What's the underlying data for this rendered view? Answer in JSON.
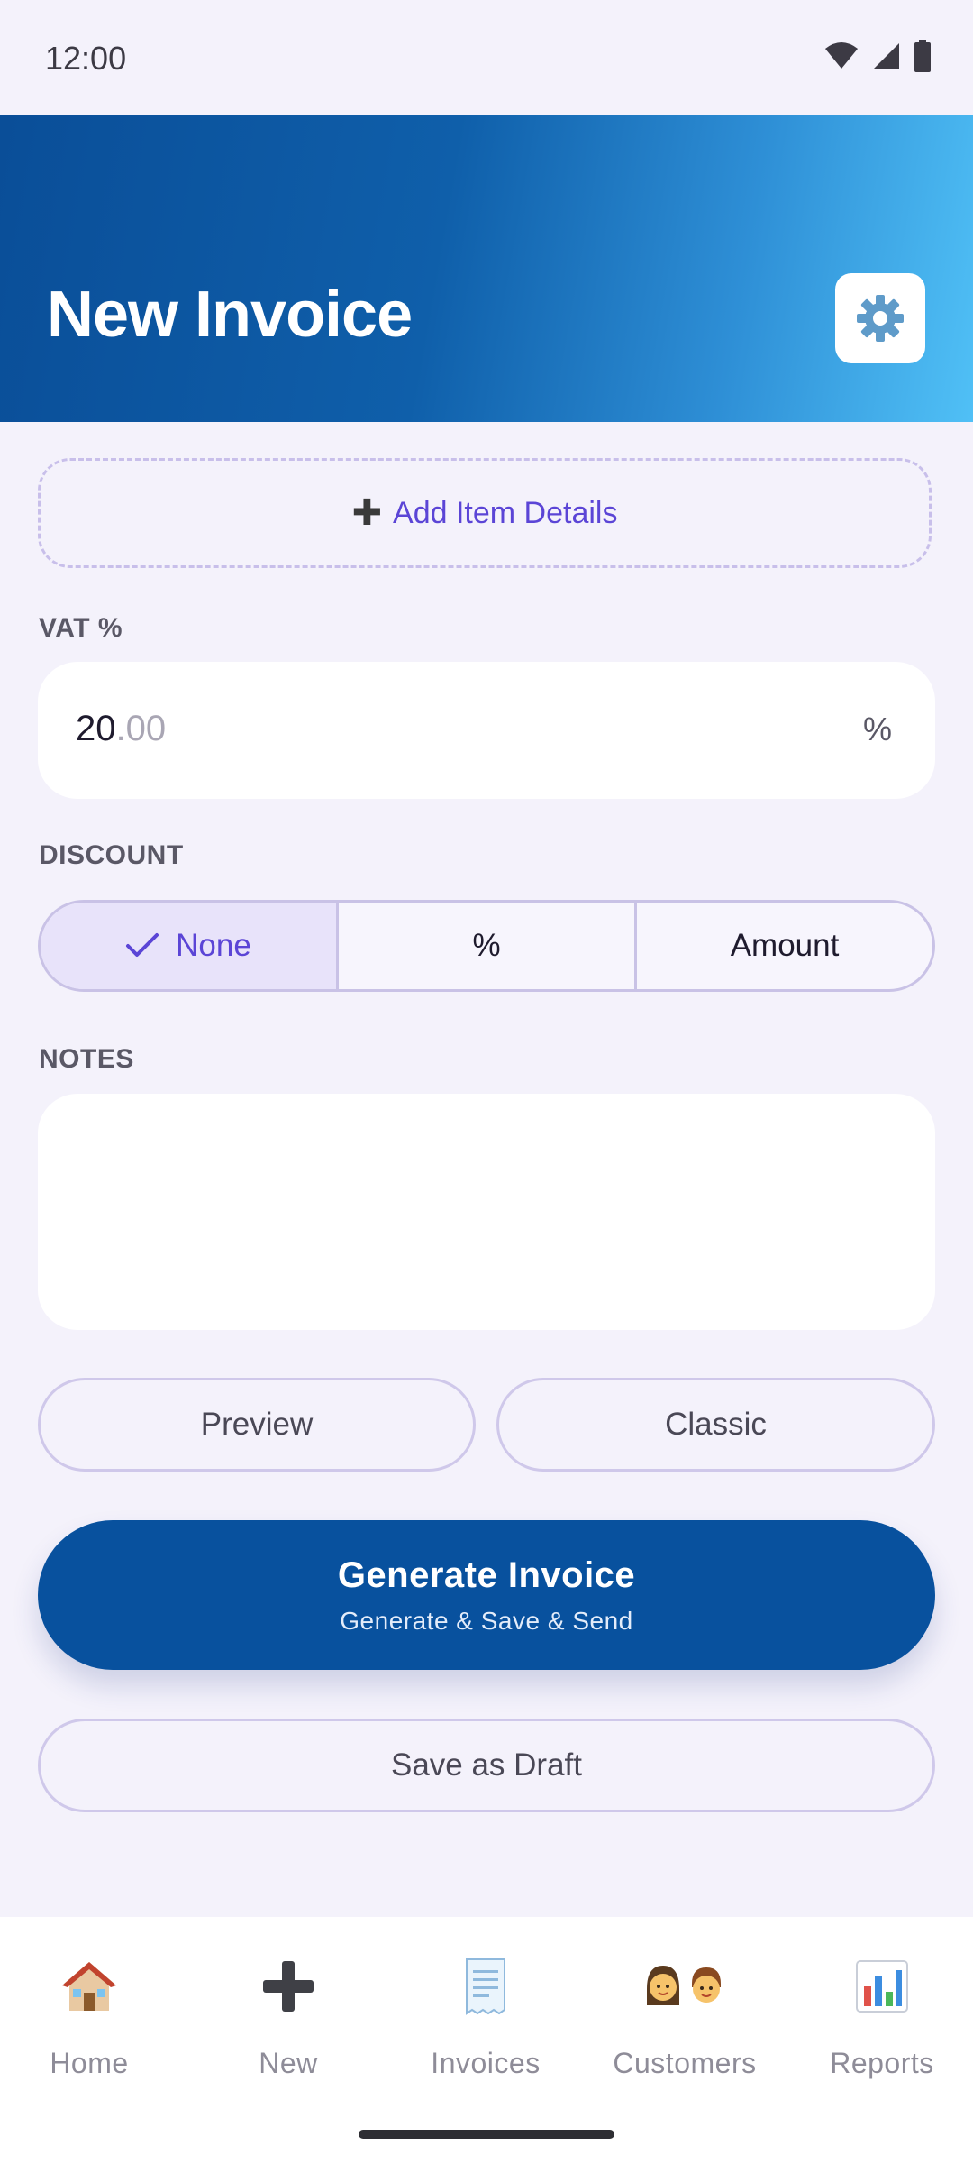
{
  "status_bar": {
    "time": "12:00"
  },
  "header": {
    "title": "New Invoice",
    "settings_icon": "gear-icon"
  },
  "add_item": {
    "label": "Add Item Details",
    "icon": "plus-icon"
  },
  "vat": {
    "label": "VAT %",
    "value_int": "20",
    "value_frac": ".00",
    "suffix": "%"
  },
  "discount": {
    "label": "DISCOUNT",
    "options": [
      "None",
      "%",
      "Amount"
    ],
    "selected": "None"
  },
  "notes": {
    "label": "NOTES",
    "value": ""
  },
  "actions": {
    "preview_label": "Preview",
    "template_label": "Classic",
    "generate_title": "Generate Invoice",
    "generate_sub": "Generate & Save & Send",
    "draft_label": "Save as Draft"
  },
  "nav": {
    "items": [
      {
        "label": "Home",
        "icon": "house-icon"
      },
      {
        "label": "New",
        "icon": "plus-icon"
      },
      {
        "label": "Invoices",
        "icon": "receipt-icon"
      },
      {
        "label": "Customers",
        "icon": "people-icon"
      },
      {
        "label": "Reports",
        "icon": "bar-chart-icon"
      }
    ]
  },
  "colors": {
    "accent": "#5B45D6",
    "primary_button": "#08519E",
    "header_gradient_start": "#0A4E98",
    "header_gradient_end": "#50C0F6",
    "background": "#F4F2FB"
  }
}
